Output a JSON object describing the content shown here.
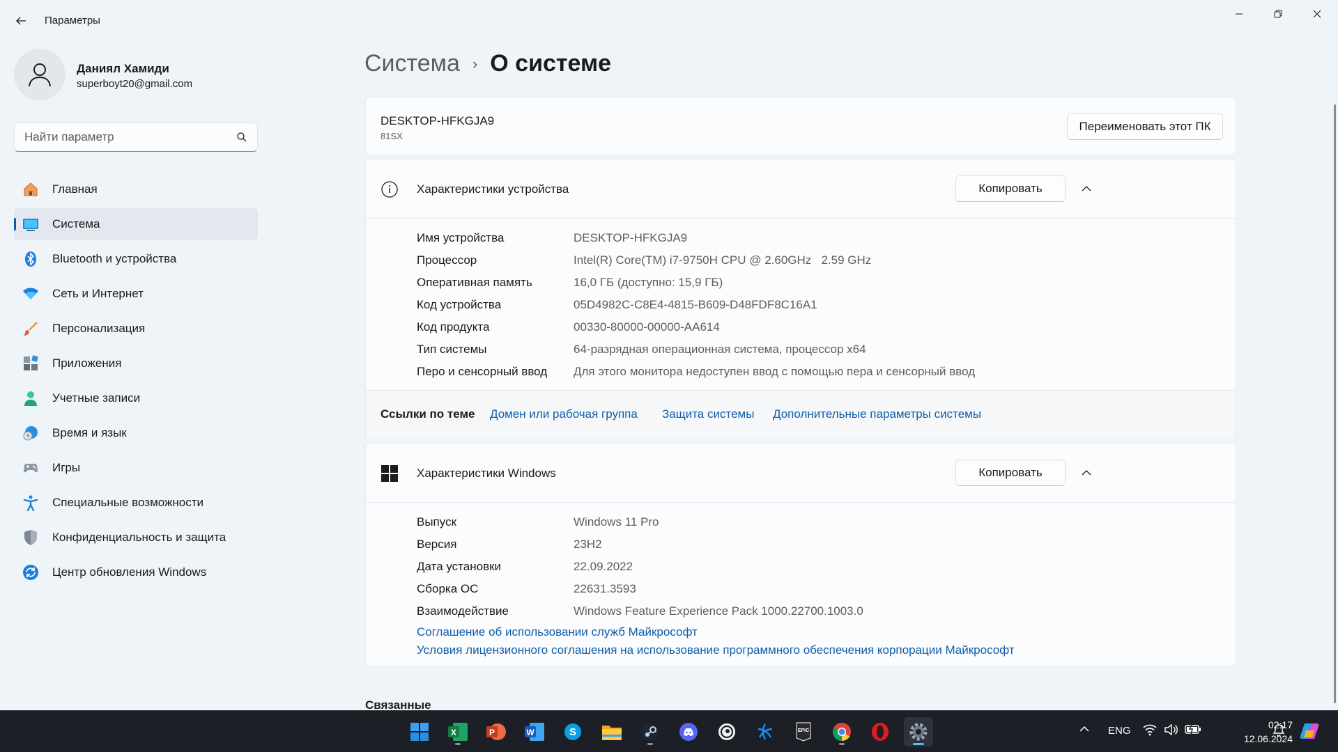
{
  "window": {
    "title": "Параметры"
  },
  "profile": {
    "name": "Даниял Хамиди",
    "email": "superboyt20@gmail.com"
  },
  "search": {
    "placeholder": "Найти параметр",
    "value": ""
  },
  "sidebar": {
    "items": [
      {
        "label": "Главная",
        "icon": "home-icon"
      },
      {
        "label": "Система",
        "icon": "system-icon",
        "active": true
      },
      {
        "label": "Bluetooth и устройства",
        "icon": "bluetooth-icon"
      },
      {
        "label": "Сеть и Интернет",
        "icon": "wifi-icon"
      },
      {
        "label": "Персонализация",
        "icon": "brush-icon"
      },
      {
        "label": "Приложения",
        "icon": "apps-icon"
      },
      {
        "label": "Учетные записи",
        "icon": "account-icon"
      },
      {
        "label": "Время и язык",
        "icon": "time-language-icon"
      },
      {
        "label": "Игры",
        "icon": "gamepad-icon"
      },
      {
        "label": "Специальные возможности",
        "icon": "accessibility-icon"
      },
      {
        "label": "Конфиденциальность и защита",
        "icon": "shield-icon"
      },
      {
        "label": "Центр обновления Windows",
        "icon": "windows-update-icon"
      }
    ]
  },
  "breadcrumb": {
    "parent": "Система",
    "separator": "›",
    "current": "О системе"
  },
  "pc": {
    "name": "DESKTOP-HFKGJA9",
    "model": "81SX",
    "rename_label": "Переименовать этот ПК"
  },
  "device_specs": {
    "title": "Характеристики устройства",
    "copy_label": "Копировать",
    "rows": [
      {
        "label": "Имя устройства",
        "value": "DESKTOP-HFKGJA9"
      },
      {
        "label": "Процессор",
        "value": "Intel(R) Core(TM) i7-9750H CPU @ 2.60GHz   2.59 GHz"
      },
      {
        "label": "Оперативная память",
        "value": "16,0 ГБ (доступно: 15,9 ГБ)"
      },
      {
        "label": "Код устройства",
        "value": "05D4982C-C8E4-4815-B609-D48FDF8C16A1"
      },
      {
        "label": "Код продукта",
        "value": "00330-80000-00000-AA614"
      },
      {
        "label": "Тип системы",
        "value": "64-разрядная операционная система, процессор x64"
      },
      {
        "label": "Перо и сенсорный ввод",
        "value": "Для этого монитора недоступен ввод с помощью пера и сенсорный ввод"
      }
    ]
  },
  "related_links": {
    "title": "Ссылки по теме",
    "links": [
      "Домен или рабочая группа",
      "Защита системы",
      "Дополнительные параметры системы"
    ]
  },
  "windows_specs": {
    "title": "Характеристики Windows",
    "copy_label": "Копировать",
    "rows": [
      {
        "label": "Выпуск",
        "value": "Windows 11 Pro"
      },
      {
        "label": "Версия",
        "value": "23H2"
      },
      {
        "label": "Дата установки",
        "value": "22.09.2022"
      },
      {
        "label": "Сборка ОС",
        "value": "22631.3593"
      },
      {
        "label": "Взаимодействие",
        "value": "Windows Feature Experience Pack 1000.22700.1003.0"
      }
    ],
    "links": [
      "Соглашение об использовании служб Майкрософт",
      "Условия лицензионного соглашения на использование программного обеспечения корпорации Майкрософт"
    ]
  },
  "related_heading": "Связанные",
  "taskbar": {
    "apps": [
      {
        "name": "start-icon"
      },
      {
        "name": "excel-icon",
        "letter": "X"
      },
      {
        "name": "powerpoint-icon",
        "letter": "P"
      },
      {
        "name": "word-icon",
        "letter": "W"
      },
      {
        "name": "skype-icon",
        "letter": "S"
      },
      {
        "name": "file-explorer-icon"
      },
      {
        "name": "steam-icon"
      },
      {
        "name": "discord-icon"
      },
      {
        "name": "ubisoft-icon"
      },
      {
        "name": "battlenet-icon"
      },
      {
        "name": "epic-games-icon",
        "letter": "EPIC"
      },
      {
        "name": "chrome-icon"
      },
      {
        "name": "opera-icon"
      },
      {
        "name": "settings-icon"
      }
    ],
    "language": "ENG",
    "time": "02:17",
    "date": "12.06.2024"
  },
  "colors": {
    "accent": "#005fb8",
    "link": "#0f5eab",
    "background": "#eff4f9",
    "card": "#fbfcfd",
    "taskbar": "#1c2026"
  }
}
